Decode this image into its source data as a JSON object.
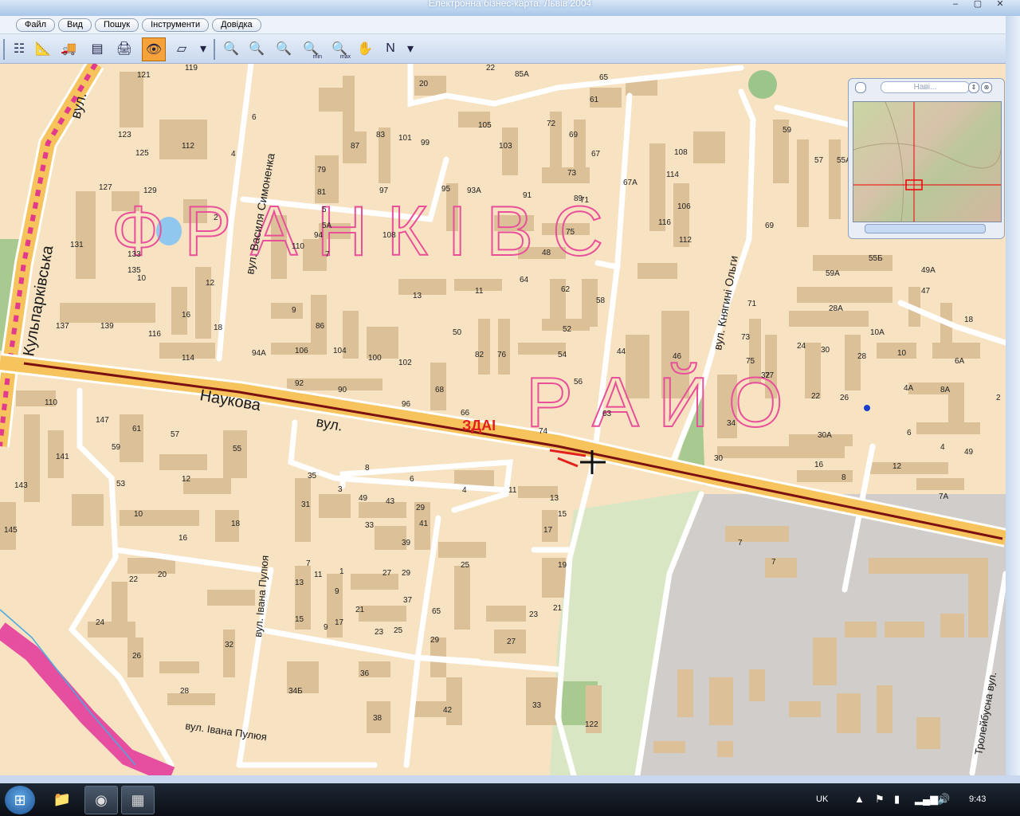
{
  "window": {
    "title": "Електронна бізнес-карта. Львів 2004"
  },
  "menu": [
    "Файл",
    "Вид",
    "Пошук",
    "Інструменти",
    "Довідка"
  ],
  "toolbar": {
    "tools": [
      {
        "name": "layers-icon",
        "glyph": "☷"
      },
      {
        "name": "measure-icon",
        "glyph": "📐"
      },
      {
        "name": "vehicle-icon",
        "glyph": "🚚"
      },
      {
        "name": "table-icon",
        "glyph": "▤"
      },
      {
        "name": "print-icon",
        "glyph": "🖨"
      },
      {
        "name": "view-eye-icon",
        "glyph": "👁",
        "active": true
      },
      {
        "name": "eraser-icon",
        "glyph": "▱"
      }
    ],
    "zoom_tools": [
      {
        "name": "zoom-out-icon",
        "glyph": "🔍"
      },
      {
        "name": "zoom-in-icon",
        "glyph": "🔍"
      },
      {
        "name": "zoom-rect-icon",
        "glyph": "🔍"
      },
      {
        "name": "zoom-min-icon",
        "glyph": "🔍",
        "sub": "min"
      },
      {
        "name": "zoom-max-icon",
        "glyph": "🔍",
        "sub": "max"
      },
      {
        "name": "pan-hand-icon",
        "glyph": "✋"
      },
      {
        "name": "north-icon",
        "glyph": "N"
      }
    ]
  },
  "navigator": {
    "title": "Наві..."
  },
  "map": {
    "district_line1": "Ф Р А Н К І В С",
    "district_line2": "Р А Й О",
    "annotation": "ЗДАІ",
    "streets": {
      "kulparkivska": "Кульпарківська",
      "kulparkivska_prefix": "вул.",
      "naukova": "Наукова",
      "naukova_prefix": "вул.",
      "symonenka": "вул. Василя Симоненка",
      "olga": "вул. Княгині Ольги",
      "puliuia_v": "вул. Івана Пулюя",
      "puliuia_h": "вул. Івана Пулюя",
      "troleibusna": "Тролейбусна вул."
    },
    "house_numbers": [
      {
        "t": "119"
      },
      {
        "t": "121"
      },
      {
        "t": "123"
      },
      {
        "t": "125"
      },
      {
        "t": "127"
      },
      {
        "t": "129"
      },
      {
        "t": "131"
      },
      {
        "t": "133"
      },
      {
        "t": "135"
      },
      {
        "t": "137"
      },
      {
        "t": "139"
      },
      {
        "t": "116"
      },
      {
        "t": "114"
      },
      {
        "t": "112"
      },
      {
        "t": "6"
      },
      {
        "t": "4"
      },
      {
        "t": "2"
      },
      {
        "t": "10"
      },
      {
        "t": "12"
      },
      {
        "t": "16"
      },
      {
        "t": "18"
      },
      {
        "t": "20"
      },
      {
        "t": "22"
      },
      {
        "t": "85А"
      },
      {
        "t": "105"
      },
      {
        "t": "103"
      },
      {
        "t": "87"
      },
      {
        "t": "83"
      },
      {
        "t": "101"
      },
      {
        "t": "99"
      },
      {
        "t": "97"
      },
      {
        "t": "95"
      },
      {
        "t": "93А"
      },
      {
        "t": "91"
      },
      {
        "t": "89"
      },
      {
        "t": "79"
      },
      {
        "t": "81"
      },
      {
        "t": "5"
      },
      {
        "t": "5А"
      },
      {
        "t": "7"
      },
      {
        "t": "110"
      },
      {
        "t": "108"
      },
      {
        "t": "9"
      },
      {
        "t": "86"
      },
      {
        "t": "106"
      },
      {
        "t": "104"
      },
      {
        "t": "100"
      },
      {
        "t": "102"
      },
      {
        "t": "92"
      },
      {
        "t": "90"
      },
      {
        "t": "96"
      },
      {
        "t": "94А"
      },
      {
        "t": "94"
      },
      {
        "t": "13"
      },
      {
        "t": "11"
      },
      {
        "t": "50"
      },
      {
        "t": "82"
      },
      {
        "t": "76"
      },
      {
        "t": "68"
      },
      {
        "t": "66"
      },
      {
        "t": "74"
      },
      {
        "t": "64"
      },
      {
        "t": "62"
      },
      {
        "t": "52"
      },
      {
        "t": "54"
      },
      {
        "t": "56"
      },
      {
        "t": "58"
      },
      {
        "t": "48"
      },
      {
        "t": "75"
      },
      {
        "t": "73"
      },
      {
        "t": "71"
      },
      {
        "t": "72"
      },
      {
        "t": "69"
      },
      {
        "t": "67"
      },
      {
        "t": "65"
      },
      {
        "t": "61"
      },
      {
        "t": "67А"
      },
      {
        "t": "63"
      },
      {
        "t": "44"
      },
      {
        "t": "46"
      },
      {
        "t": "116"
      },
      {
        "t": "112"
      },
      {
        "t": "114"
      },
      {
        "t": "108"
      },
      {
        "t": "106"
      },
      {
        "t": "110"
      },
      {
        "t": "141"
      },
      {
        "t": "143"
      },
      {
        "t": "145"
      },
      {
        "t": "147"
      },
      {
        "t": "61"
      },
      {
        "t": "59"
      },
      {
        "t": "57"
      },
      {
        "t": "55"
      },
      {
        "t": "53"
      },
      {
        "t": "12"
      },
      {
        "t": "10"
      },
      {
        "t": "16"
      },
      {
        "t": "18"
      },
      {
        "t": "8"
      },
      {
        "t": "6"
      },
      {
        "t": "4"
      },
      {
        "t": "49"
      },
      {
        "t": "43"
      },
      {
        "t": "29"
      },
      {
        "t": "41"
      },
      {
        "t": "39"
      },
      {
        "t": "31"
      },
      {
        "t": "33"
      },
      {
        "t": "35"
      },
      {
        "t": "3"
      },
      {
        "t": "7"
      },
      {
        "t": "1"
      },
      {
        "t": "9"
      },
      {
        "t": "11"
      },
      {
        "t": "13"
      },
      {
        "t": "15"
      },
      {
        "t": "17"
      },
      {
        "t": "19"
      },
      {
        "t": "25"
      },
      {
        "t": "21"
      },
      {
        "t": "23"
      },
      {
        "t": "27"
      },
      {
        "t": "22"
      },
      {
        "t": "20"
      },
      {
        "t": "24"
      },
      {
        "t": "26"
      },
      {
        "t": "28"
      },
      {
        "t": "32"
      },
      {
        "t": "34Б"
      },
      {
        "t": "36"
      },
      {
        "t": "38"
      },
      {
        "t": "42"
      },
      {
        "t": "33"
      },
      {
        "t": "122"
      },
      {
        "t": "27"
      },
      {
        "t": "29"
      },
      {
        "t": "37"
      },
      {
        "t": "13"
      },
      {
        "t": "11"
      },
      {
        "t": "9"
      },
      {
        "t": "15"
      },
      {
        "t": "17"
      },
      {
        "t": "21"
      },
      {
        "t": "23"
      },
      {
        "t": "25"
      },
      {
        "t": "29"
      },
      {
        "t": "65"
      },
      {
        "t": "59"
      },
      {
        "t": "57"
      },
      {
        "t": "55А"
      },
      {
        "t": "55Б"
      },
      {
        "t": "59А"
      },
      {
        "t": "69"
      },
      {
        "t": "71"
      },
      {
        "t": "73"
      },
      {
        "t": "75"
      },
      {
        "t": "77"
      },
      {
        "t": "34"
      },
      {
        "t": "32"
      },
      {
        "t": "22"
      },
      {
        "t": "26"
      },
      {
        "t": "24"
      },
      {
        "t": "30"
      },
      {
        "t": "28"
      },
      {
        "t": "28А"
      },
      {
        "t": "10А"
      },
      {
        "t": "10"
      },
      {
        "t": "6А"
      },
      {
        "t": "4А"
      },
      {
        "t": "8А"
      },
      {
        "t": "6"
      },
      {
        "t": "4"
      },
      {
        "t": "2"
      },
      {
        "t": "49"
      },
      {
        "t": "49А"
      },
      {
        "t": "47"
      },
      {
        "t": "18"
      },
      {
        "t": "30А"
      },
      {
        "t": "30"
      },
      {
        "t": "16"
      },
      {
        "t": "8"
      },
      {
        "t": "12"
      },
      {
        "t": "7А"
      },
      {
        "t": "7"
      },
      {
        "t": "7"
      }
    ]
  },
  "taskbar": {
    "lang": "UK",
    "clock": "9:43"
  }
}
